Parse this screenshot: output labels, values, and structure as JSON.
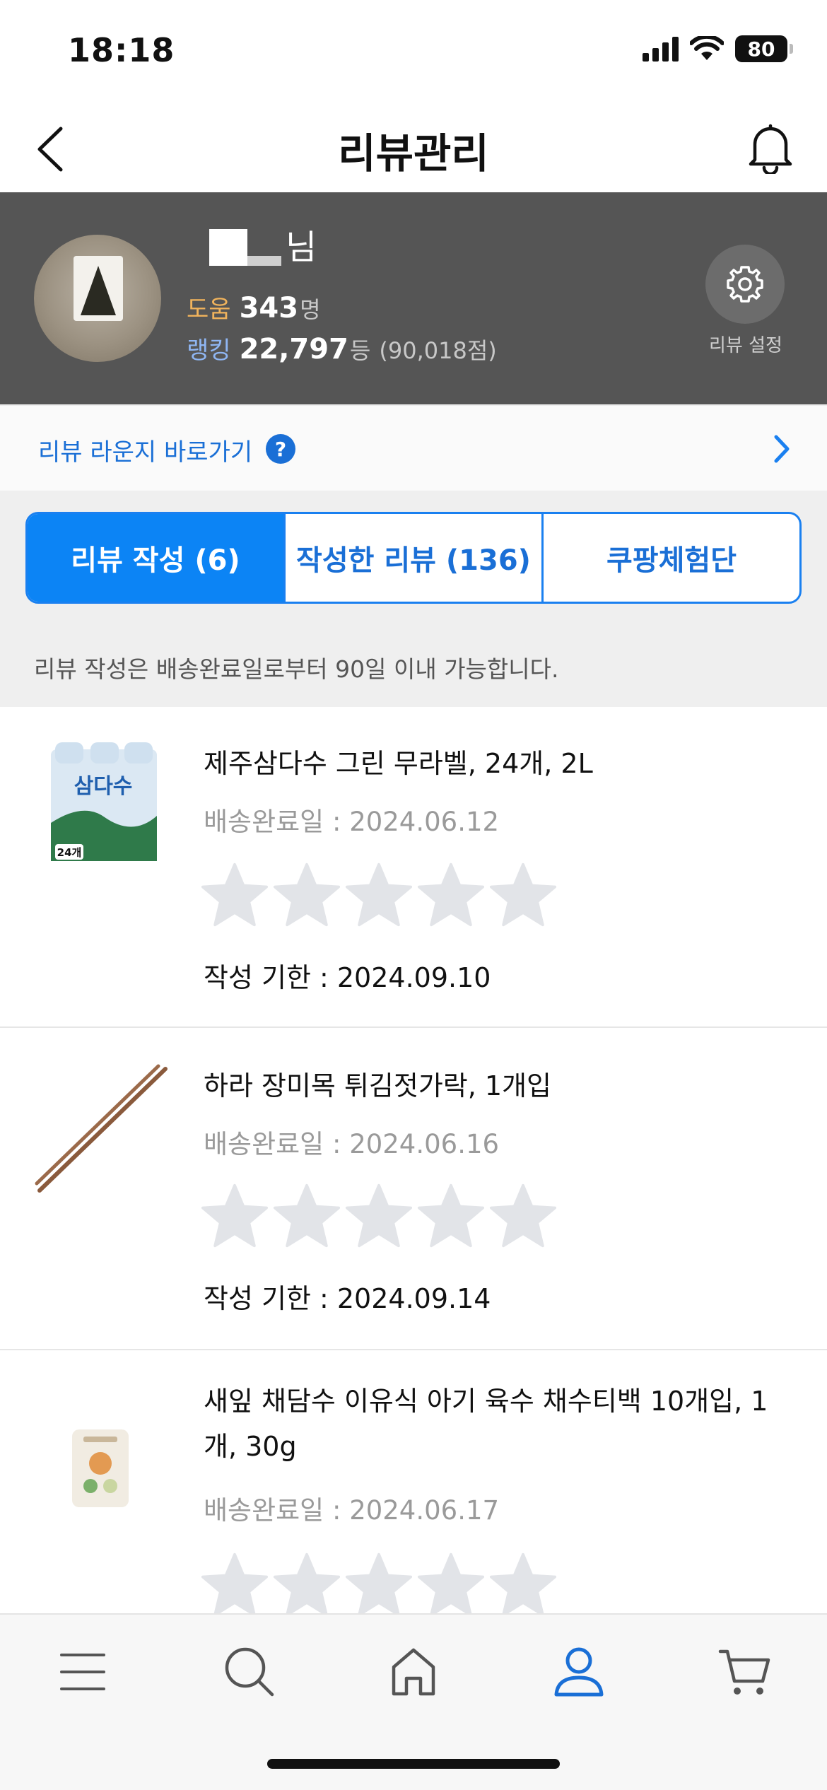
{
  "status_bar": {
    "time": "18:18",
    "battery": "80"
  },
  "header": {
    "title": "리뷰관리"
  },
  "profile": {
    "name_suffix": "님",
    "help_label": "도움",
    "help_value": "343",
    "help_unit": "명",
    "rank_label": "랭킹",
    "rank_value": "22,797",
    "rank_unit": "등",
    "rank_points": "(90,018점)",
    "settings_label": "리뷰 설정"
  },
  "lounge": {
    "label": "리뷰 라운지 바로가기",
    "help_icon": "?"
  },
  "tabs": [
    {
      "label": "리뷰 작성 (6)",
      "active": true
    },
    {
      "label": "작성한 리뷰 (136)",
      "active": false
    },
    {
      "label": "쿠팡체험단",
      "active": false
    }
  ],
  "notice": "리뷰 작성은 배송완료일로부터 90일 이내 가능합니다.",
  "products": [
    {
      "name": "제주삼다수 그린 무라벨, 24개, 2L",
      "delivery": "배송완료일 : 2024.06.12",
      "deadline": "작성 기한 : 2024.09.10",
      "rating": 0,
      "thumb_label": "삼다수",
      "thumb_badge": "24개"
    },
    {
      "name": "하라 장미목 튀김젓가락, 1개입",
      "delivery": "배송완료일 : 2024.06.16",
      "deadline": "작성 기한 : 2024.09.14",
      "rating": 0
    },
    {
      "name": "새잎 채담수 이유식 아기 육수 채수티백 10개입, 1개, 30g",
      "delivery": "배송완료일 : 2024.06.17",
      "rating": 0
    }
  ],
  "bottom_nav": [
    {
      "icon": "menu-icon",
      "active": false
    },
    {
      "icon": "search-icon",
      "active": false
    },
    {
      "icon": "home-icon",
      "active": false
    },
    {
      "icon": "profile-icon",
      "active": true
    },
    {
      "icon": "cart-icon",
      "active": false
    }
  ],
  "colors": {
    "accent": "#0c84f5",
    "link": "#1a6fd6",
    "profile_bg": "#555555",
    "help_label": "#f2b45c",
    "rank_label": "#8fb6f3",
    "star_empty": "#e2e4e8"
  }
}
